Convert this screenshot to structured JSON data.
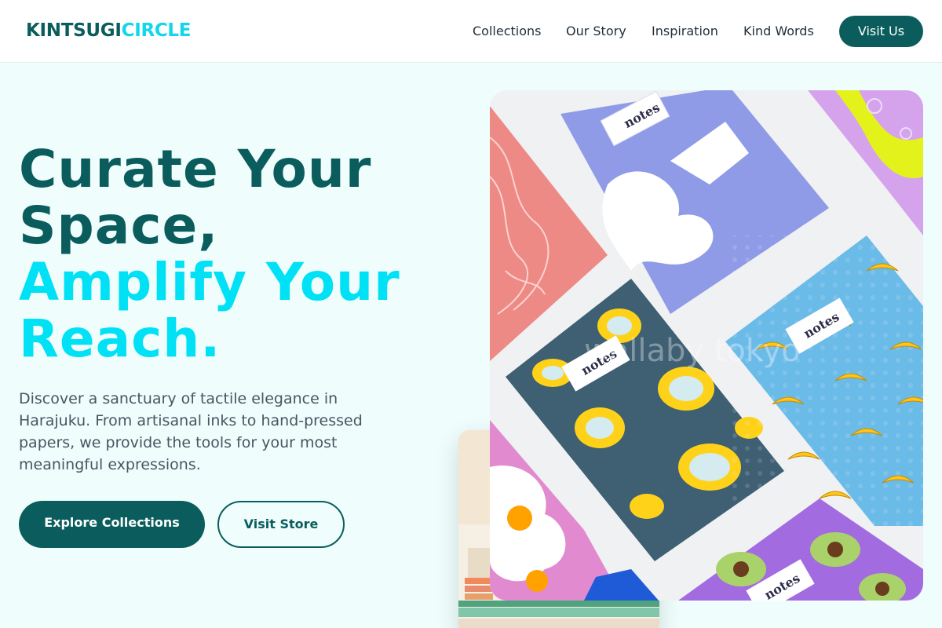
{
  "brand": {
    "part1": "KINTSUGI",
    "part2": "CIRCLE"
  },
  "nav": {
    "items": [
      "Collections",
      "Our Story",
      "Inspiration",
      "Kind Words"
    ],
    "cta": "Visit Us"
  },
  "hero": {
    "headline_dark": [
      "Curate Your",
      "Space,"
    ],
    "headline_bright": [
      "Amplify Your",
      "Reach."
    ],
    "description": "Discover a sanctuary of tactile elegance in Harajuku. From artisanal inks to hand-pressed papers, we provide the tools for your most meaningful expressions.",
    "primary_button": "Explore Collections",
    "secondary_button": "Visit Store"
  },
  "image": {
    "notebook_label": "notes",
    "watermark": "wallaby tokyo"
  },
  "colors": {
    "teal": "#0b5d5d",
    "cyan": "#00e1f5",
    "background": "#effdfd"
  }
}
